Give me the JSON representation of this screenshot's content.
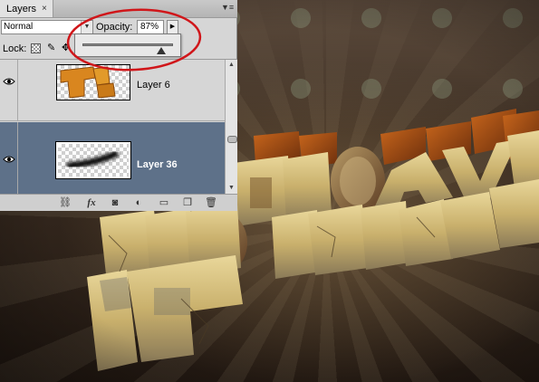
{
  "panel": {
    "tab_label": "Layers",
    "close_glyph": "×",
    "menu_glyph": "▼≡",
    "blend_mode": "Normal",
    "opacity_label": "Opacity:",
    "opacity_value": "87%",
    "opacity_fraction": 0.87,
    "lock_label": "Lock:",
    "layers": [
      {
        "name": "Layer 6",
        "visible": true,
        "selected": false
      },
      {
        "name": "Layer 36",
        "visible": true,
        "selected": true
      }
    ],
    "toolbar_icons": [
      "link-icon",
      "fx-icon",
      "mask-icon",
      "adjustment-icon",
      "folder-icon",
      "new-layer-icon",
      "trash-icon"
    ],
    "fx_label": "fx"
  },
  "colors": {
    "selected_row": "#5e7189",
    "annotation": "#d0161a",
    "panel_bg": "#d6d6d6"
  }
}
